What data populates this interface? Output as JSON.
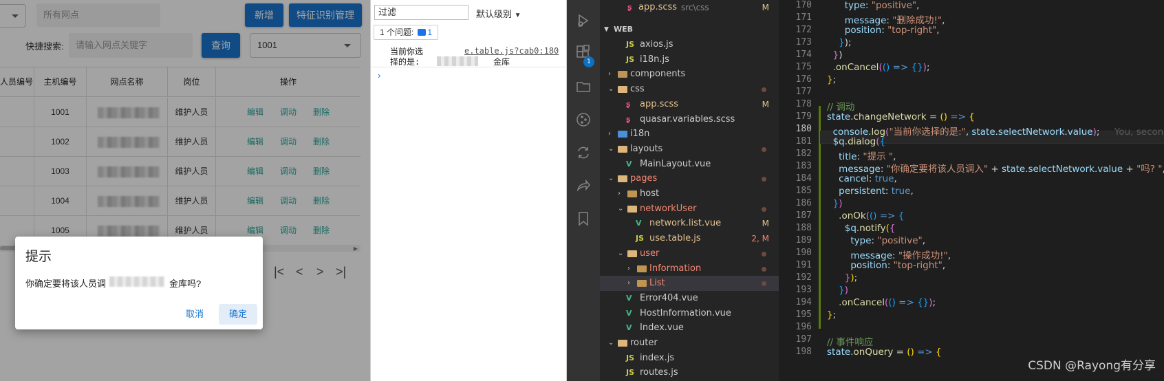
{
  "app": {
    "search_placeholder": "所有网点",
    "btn_add": "新增",
    "btn_feature": "特征识别管理",
    "quick_search_label": "快捷搜索:",
    "quick_search_placeholder": "请输入网点关键字",
    "btn_query": "查询",
    "network_select_value": "1001",
    "table_headers": [
      "人员编号",
      "主机编号",
      "网点名称",
      "岗位",
      "操作"
    ],
    "rows": [
      {
        "host": "1001",
        "post": "维护人员"
      },
      {
        "host": "1002",
        "post": "维护人员"
      },
      {
        "host": "1003",
        "post": "维护人员"
      },
      {
        "host": "1004",
        "post": "维护人员"
      },
      {
        "host": "1005",
        "post": "维护人员"
      }
    ],
    "op_edit": "编辑",
    "op_transfer": "调动",
    "op_delete": "删除",
    "dialog": {
      "title": "提示",
      "message_prefix": "你确定要将该人员调",
      "message_suffix": "金库吗?",
      "cancel": "取消",
      "ok": "确定"
    }
  },
  "console": {
    "filter_value": "过滤",
    "level_label": "默认级别",
    "issues_label": "1 个问题:",
    "issues_count": "1",
    "log_line1": "当前你选",
    "log_line2": "择的是:",
    "log_tail": "金库",
    "log_source": "e.table.js?cab0:180",
    "prompt_symbol": "›"
  },
  "vscode": {
    "badge_count": "1",
    "explorer": {
      "top_file_name": "app.scss",
      "top_file_path": "src\\css",
      "top_file_status": "M",
      "section": "WEB",
      "items": [
        {
          "name": "axios.js",
          "type": "js",
          "indent": 2
        },
        {
          "name": "i18n.js",
          "type": "js",
          "indent": 2
        },
        {
          "name": "components",
          "type": "folder",
          "indent": 1,
          "state": "closed"
        },
        {
          "name": "css",
          "type": "folder-blue",
          "indent": 1,
          "state": "open"
        },
        {
          "name": "app.scss",
          "type": "scss",
          "indent": 2,
          "status": "M"
        },
        {
          "name": "quasar.variables.scss",
          "type": "scss",
          "indent": 2
        },
        {
          "name": "i18n",
          "type": "folder-blue",
          "indent": 1,
          "state": "closed"
        },
        {
          "name": "layouts",
          "type": "folder-red",
          "indent": 1,
          "state": "open"
        },
        {
          "name": "MainLayout.vue",
          "type": "vue",
          "indent": 2
        },
        {
          "name": "pages",
          "type": "folder-red",
          "indent": 1,
          "state": "open"
        },
        {
          "name": "host",
          "type": "folder",
          "indent": 2,
          "state": "closed"
        },
        {
          "name": "networkUser",
          "type": "folder",
          "indent": 2,
          "state": "open"
        },
        {
          "name": "network.list.vue",
          "type": "vue",
          "indent": 3,
          "status": "M"
        },
        {
          "name": "use.table.js",
          "type": "js",
          "indent": 3,
          "status": "2, M"
        },
        {
          "name": "user",
          "type": "folder",
          "indent": 2,
          "state": "open"
        },
        {
          "name": "Information",
          "type": "folder",
          "indent": 3,
          "state": "closed"
        },
        {
          "name": "List",
          "type": "folder",
          "indent": 3,
          "state": "closed"
        },
        {
          "name": "Error404.vue",
          "type": "vue",
          "indent": 2
        },
        {
          "name": "HostInformation.vue",
          "type": "vue",
          "indent": 2
        },
        {
          "name": "Index.vue",
          "type": "vue",
          "indent": 2
        },
        {
          "name": "router",
          "type": "folder",
          "indent": 1,
          "state": "open"
        },
        {
          "name": "index.js",
          "type": "js",
          "indent": 2
        },
        {
          "name": "routes.js",
          "type": "js",
          "indent": 2
        }
      ]
    },
    "line_numbers": [
      "170",
      "171",
      "172",
      "173",
      "174",
      "175",
      "176",
      "177",
      "178",
      "179",
      "180",
      "181",
      "182",
      "183",
      "184",
      "185",
      "186",
      "187",
      "188",
      "189",
      "190",
      "191",
      "192",
      "193",
      "194",
      "195",
      "196",
      "197",
      "198"
    ],
    "blame": "You, second",
    "watermark": "CSDN @Rayong有分享"
  }
}
